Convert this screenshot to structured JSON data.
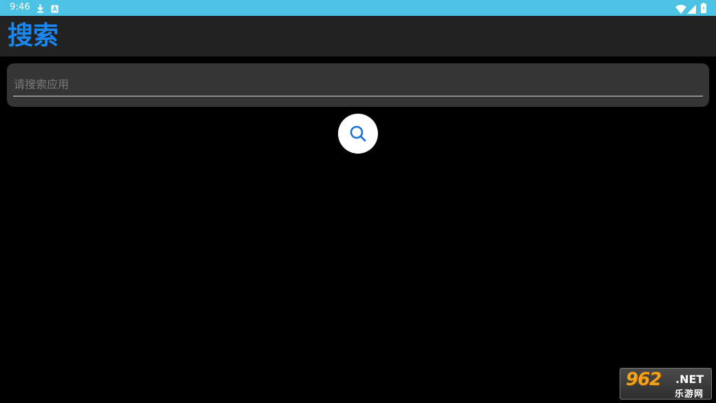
{
  "status_bar": {
    "time": "9:46",
    "icons": [
      "download-icon",
      "a-notification-icon",
      "wifi-icon",
      "signal-icon",
      "battery-icon"
    ]
  },
  "app_bar": {
    "title": "搜索"
  },
  "search": {
    "placeholder": "请搜索应用",
    "value": ""
  },
  "search_button": {
    "icon": "search-icon"
  },
  "watermark": {
    "number": "962",
    "domain": ".NET",
    "subtitle": "乐游网"
  },
  "colors": {
    "status_bar": "#4cc3e4",
    "app_bar": "#222222",
    "accent": "#1a86f0",
    "background": "#000000",
    "search_field": "#353535",
    "button": "#ffffff"
  }
}
